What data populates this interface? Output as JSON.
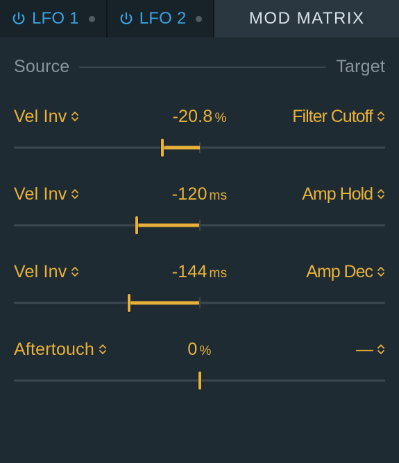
{
  "tabs": {
    "lfo1": "LFO 1",
    "lfo2": "LFO 2",
    "modmatrix": "MOD MATRIX"
  },
  "header": {
    "source": "Source",
    "target": "Target"
  },
  "rows": [
    {
      "source": "Vel Inv",
      "value": "-20.8",
      "unit": "%",
      "target": "Filter Cutoff",
      "slider": {
        "handle_pct": 40,
        "fill_from_pct": 40,
        "fill_to_pct": 50
      }
    },
    {
      "source": "Vel Inv",
      "value": "-120",
      "unit": "ms",
      "target": "Amp Hold",
      "slider": {
        "handle_pct": 33,
        "fill_from_pct": 33,
        "fill_to_pct": 50
      }
    },
    {
      "source": "Vel Inv",
      "value": "-144",
      "unit": "ms",
      "target": "Amp Dec",
      "slider": {
        "handle_pct": 31,
        "fill_from_pct": 31,
        "fill_to_pct": 50
      }
    },
    {
      "source": "Aftertouch",
      "value": "0",
      "unit": "%",
      "target": "—",
      "slider": {
        "handle_pct": 50,
        "fill_from_pct": 50,
        "fill_to_pct": 50
      }
    }
  ]
}
